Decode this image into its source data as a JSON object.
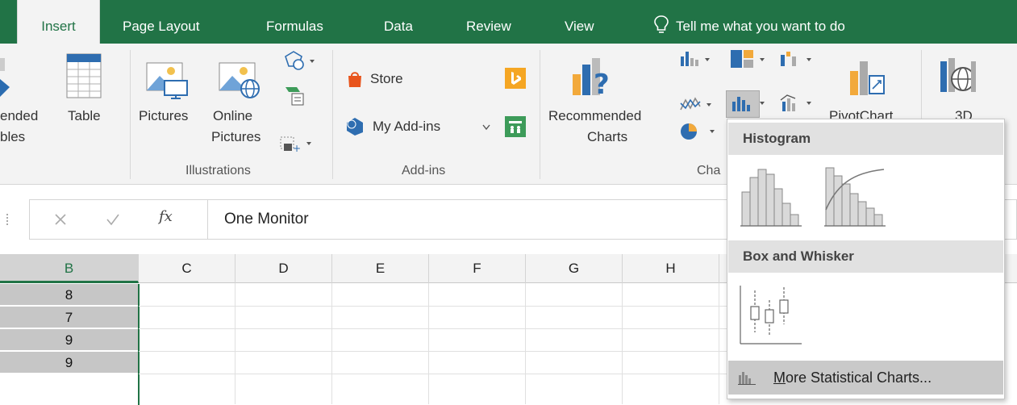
{
  "tabs": [
    {
      "label": "Insert",
      "active": true
    },
    {
      "label": "Page Layout"
    },
    {
      "label": "Formulas"
    },
    {
      "label": "Data"
    },
    {
      "label": "Review"
    },
    {
      "label": "View"
    }
  ],
  "tell_me": "Tell me what you want to do",
  "ribbon": {
    "tables_partial": {
      "line1": "ended",
      "line2": "bles"
    },
    "table_label": "Table",
    "pictures_label": "Pictures",
    "online_pictures": {
      "line1": "Online",
      "line2": "Pictures"
    },
    "store_label": "Store",
    "my_addins_label": "My Add-ins",
    "recommended_charts": {
      "line1": "Recommended",
      "line2": "Charts"
    },
    "pivotchart_partial": "PivotChart",
    "map3d_partial": "3D",
    "groups": {
      "illustrations": "Illustrations",
      "addins": "Add-ins",
      "charts_partial": "Cha"
    }
  },
  "formula_bar": {
    "fx": "fx",
    "value": "One Monitor"
  },
  "columns": [
    "B",
    "C",
    "D",
    "E",
    "F",
    "G",
    "H"
  ],
  "rows": [
    {
      "b": "8"
    },
    {
      "b": "7"
    },
    {
      "b": "9"
    },
    {
      "b": "9"
    }
  ],
  "dropdown": {
    "histogram_header": "Histogram",
    "box_header": "Box and Whisker",
    "more_label": "More Statistical Charts...",
    "more_mnemonic": "M",
    "more_rest": "ore Statistical Charts..."
  },
  "colors": {
    "brand_green": "#217346",
    "ribbon_bg": "#f3f3f3"
  }
}
